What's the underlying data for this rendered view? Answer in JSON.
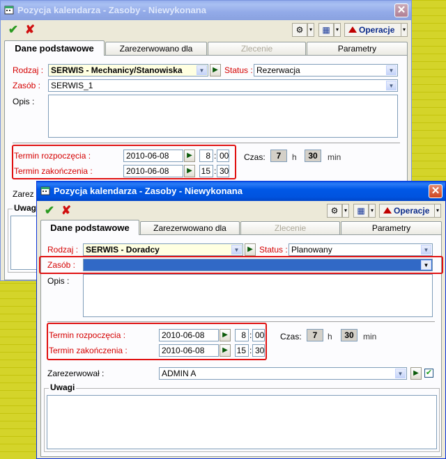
{
  "window1": {
    "title": "Pozycja kalendarza - Zasoby - Niewykonana",
    "close_glyph": "✕",
    "toolbar": {
      "ok_icon": "check-icon",
      "cancel_icon": "x-icon",
      "ok_glyph": "✔",
      "cancel_glyph": "✘",
      "gear_glyph": "⚙",
      "grid_glyph": "▦",
      "arrow_glyph": "▾",
      "operations_label": "Operacje"
    },
    "tabs": [
      {
        "label": "Dane podstawowe",
        "state": "active"
      },
      {
        "label": "Zarezerwowano dla",
        "state": "normal"
      },
      {
        "label": "Zlecenie",
        "state": "disabled"
      },
      {
        "label": "Parametry",
        "state": "normal"
      }
    ],
    "rodzaj_label": "Rodzaj :",
    "rodzaj_value": "SERWIS - Mechanicy/Stanowiska",
    "status_label": "Status :",
    "status_value": "Rezerwacja",
    "zasob_label": "Zasób :",
    "zasob_value": "SERWIS_1",
    "opis_label": "Opis :",
    "start_label": "Termin rozpoczęcia :",
    "start_date": "2010-06-08",
    "start_hour": "8",
    "start_min": "00",
    "end_label": "Termin zakończenia :",
    "end_date": "2010-06-08",
    "end_hour": "15",
    "end_min": "30",
    "czas_label": "Czas:",
    "czas_h": "7",
    "h_label": "h",
    "czas_min": "30",
    "min_label": "min",
    "partial_label": "Zarez",
    "partial_group": "Uwag"
  },
  "window2": {
    "title": "Pozycja kalendarza - Zasoby - Niewykonana",
    "close_glyph": "✕",
    "toolbar": {
      "ok_glyph": "✔",
      "cancel_glyph": "✘",
      "gear_glyph": "⚙",
      "grid_glyph": "▦",
      "arrow_glyph": "▾",
      "operations_label": "Operacje"
    },
    "tabs": [
      {
        "label": "Dane podstawowe",
        "state": "active"
      },
      {
        "label": "Zarezerwowano dla",
        "state": "normal"
      },
      {
        "label": "Zlecenie",
        "state": "disabled"
      },
      {
        "label": "Parametry",
        "state": "normal"
      }
    ],
    "rodzaj_label": "Rodzaj :",
    "rodzaj_value": "SERWIS - Doradcy",
    "status_label": "Status :",
    "status_value": "Planowany",
    "zasob_label": "Zasób :",
    "zasob_value": "",
    "opis_label": "Opis :",
    "start_label": "Termin rozpoczęcia :",
    "start_date": "2010-06-08",
    "start_hour": "8",
    "start_min": "00",
    "end_label": "Termin zakończenia :",
    "end_date": "2010-06-08",
    "end_hour": "15",
    "end_min": "30",
    "czas_label": "Czas:",
    "czas_h": "7",
    "h_label": "h",
    "czas_min": "30",
    "min_label": "min",
    "zarezerwowal_label": "Zarezerwował :",
    "zarezerwowal_value": "ADMIN A",
    "check_glyph": "✔",
    "uwagi_label": "Uwagi"
  },
  "colors": {
    "highlight_box": "#e01010",
    "title_active": "#0058e6",
    "label_red": "#d50000",
    "selection": "#3169c6"
  }
}
